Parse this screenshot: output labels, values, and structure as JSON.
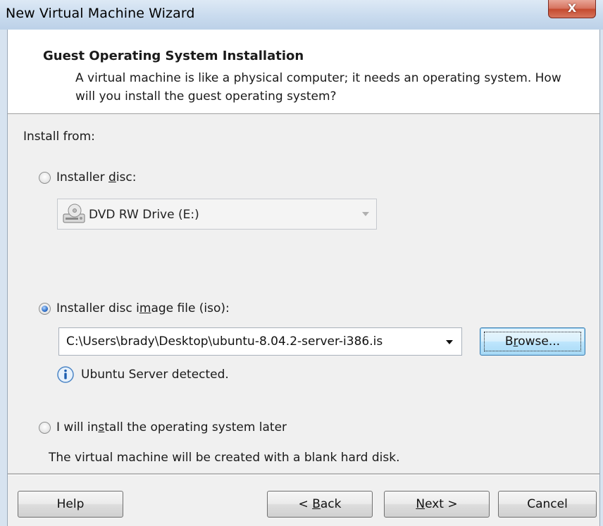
{
  "window": {
    "title": "New Virtual Machine Wizard",
    "close_label": "X"
  },
  "header": {
    "title": "Guest Operating System Installation",
    "description": "A virtual machine is like a physical computer; it needs an operating system. How will you install the guest operating system?"
  },
  "install_from": {
    "label": "Install from:",
    "installer_disc": {
      "label_before": "Installer ",
      "label_accel": "d",
      "label_after": "isc:",
      "selected": false,
      "drive_value": "DVD RW Drive (E:)",
      "drive_icon": "dvd-drive-icon"
    },
    "iso": {
      "label_before": "Installer disc i",
      "label_accel": "m",
      "label_after": "age file (iso):",
      "selected": true,
      "path_value": "C:\\Users\\brady\\Desktop\\ubuntu-8.04.2-server-i386.is",
      "browse_before": "B",
      "browse_accel": "r",
      "browse_after": "owse...",
      "detected_text": "Ubuntu Server detected.",
      "detected_icon": "info-icon"
    },
    "later": {
      "label_before": "I will in",
      "label_accel": "s",
      "label_after": "tall the operating system later",
      "selected": false,
      "note": "The virtual machine will be created with a blank hard disk."
    }
  },
  "footer": {
    "help_label": "Help",
    "back_before": "< ",
    "back_accel": "B",
    "back_after": "ack",
    "next_accel": "N",
    "next_after": "ext >",
    "cancel_label": "Cancel"
  },
  "colors": {
    "title_bar": "#c9dbee",
    "close_button": "#c44a2f",
    "panel_background": "#f0f0f0",
    "focus_blue": "#3c7fb1"
  }
}
